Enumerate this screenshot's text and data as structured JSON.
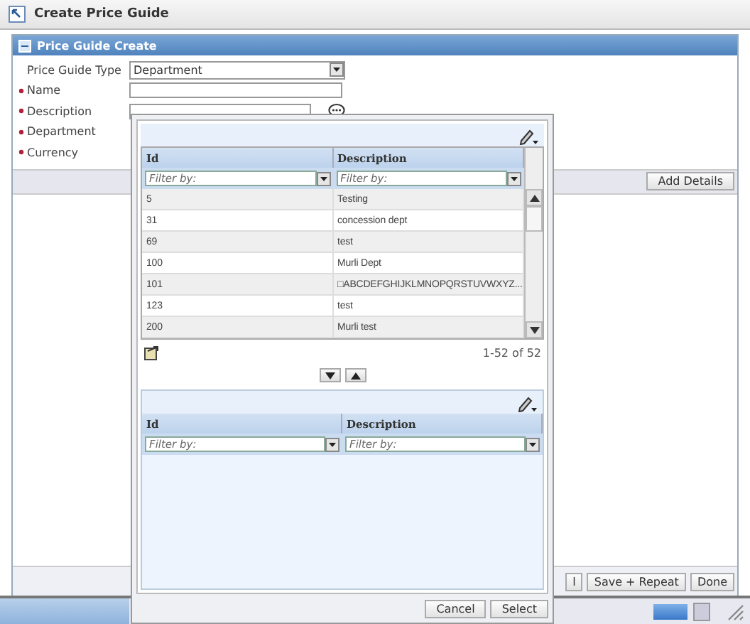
{
  "window": {
    "title": "Create Price Guide"
  },
  "panel": {
    "title": "Price Guide Create",
    "expanded": true
  },
  "form": [
    {
      "label": "Price Guide Type",
      "required": false,
      "kind": "select",
      "value": "Department"
    },
    {
      "label": "Name",
      "required": true,
      "kind": "text"
    },
    {
      "label": "Description",
      "required": true,
      "kind": "comment"
    },
    {
      "label": "Department",
      "required": true,
      "kind": "covered"
    },
    {
      "label": "Currency",
      "required": true,
      "kind": "covered"
    }
  ],
  "add_details_button": "Add Details",
  "footer_buttons": [
    "l",
    "Save + Repeat",
    "Done"
  ],
  "popup": {
    "upper_grid": {
      "columns": [
        "Id",
        "Description"
      ],
      "filters": [
        {
          "placeholder": "Filter by:"
        },
        {
          "placeholder": "Filter by:"
        }
      ],
      "rows": [
        [
          "5",
          "Testing"
        ],
        [
          "31",
          "concession dept"
        ],
        [
          "69",
          "test"
        ],
        [
          "100",
          "Murli Dept"
        ],
        [
          "101",
          "□ABCDEFGHIJKLMNOPQRSTUVWXYZ..."
        ],
        [
          "123",
          "test"
        ],
        [
          "200",
          "Murli test"
        ]
      ]
    },
    "record_count": "1-52 of 52",
    "lower_grid": {
      "columns": [
        "Id",
        "Description"
      ],
      "filters": [
        {
          "placeholder": "Filter by:"
        },
        {
          "placeholder": "Filter by:"
        }
      ]
    },
    "buttons": [
      "Cancel",
      "Select"
    ]
  }
}
